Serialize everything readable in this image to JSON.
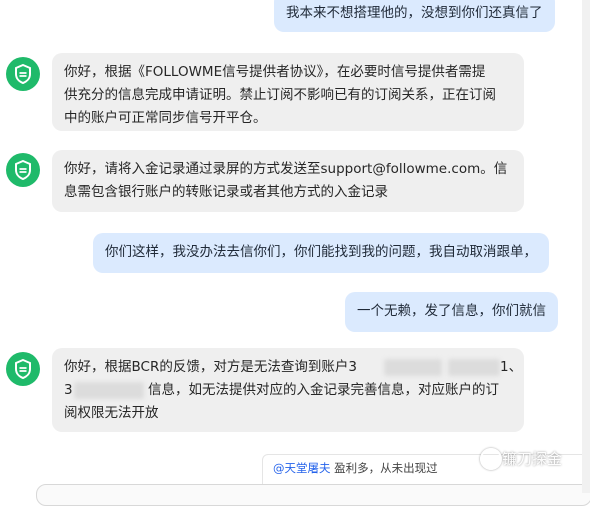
{
  "messages": [
    {
      "role": "user",
      "text": "我本来不想搭理他的，没想到你们还真信了"
    },
    {
      "role": "bot",
      "lines": [
        "你好，根据《FOLLOWME信号提供者协议》，在必要时信号提供者需提",
        "供充分的信息完成申请证明。禁止订阅不影响已有的订阅关系，正在订阅",
        "中的账户可正常同步信号开平仓。"
      ]
    },
    {
      "role": "bot",
      "lines": [
        "你好，请将入金记录通过录屏的方式发送至support@followme.com。信",
        "息需包含银行账户的转账记录或者其他方式的入金记录"
      ]
    },
    {
      "role": "user",
      "text": "你们这样，我没办法去信你们，你们能找到我的问题，我自动取消跟单，"
    },
    {
      "role": "user",
      "text": "一个无赖，发了信息，你们就信"
    },
    {
      "role": "bot",
      "lines": [
        "你好，根据BCR的反馈，对方是无法查询到账户3",
        "1、",
        "3",
        "信息，如无法提供对应的入金记录完善信息，对应账户的订",
        "阅权限无法开放"
      ]
    }
  ],
  "quote": {
    "mention": "@天堂屠夫",
    "text": " 盈利多，从未出现过"
  },
  "watermark": "镰刀探金",
  "colors": {
    "user_bubble": "#dbeafe",
    "bot_bubble": "#efefef",
    "avatar": "#1fba6a",
    "mention": "#2563eb"
  },
  "icons": {
    "avatar": "shield-icon"
  }
}
